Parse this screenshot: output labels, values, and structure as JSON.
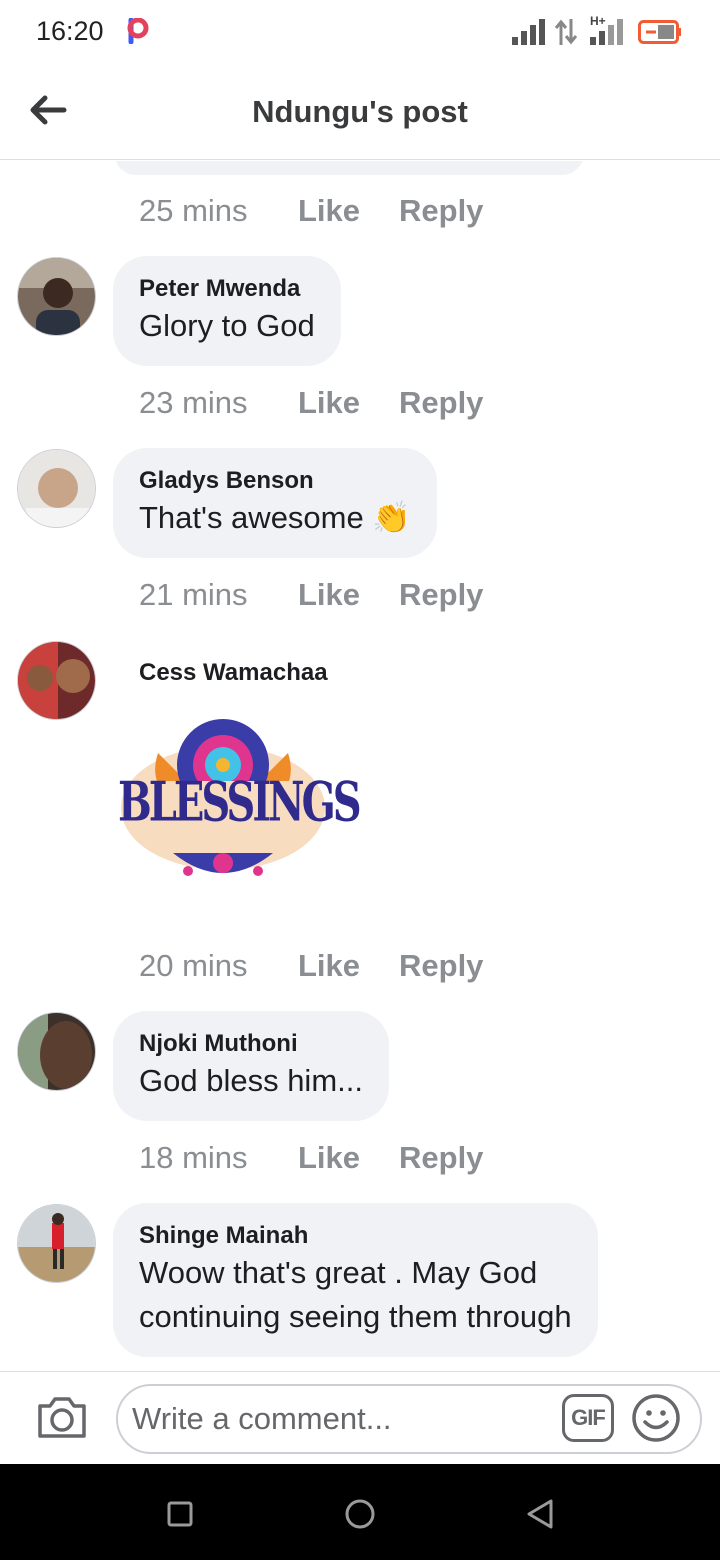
{
  "status_bar": {
    "time": "16:20",
    "network_label": "H+",
    "icons": [
      "pinterest-style-app-badge",
      "signal-bars-icon",
      "data-arrows-icon",
      "signal-bars-icon",
      "battery-icon"
    ],
    "colors": {
      "app_badge_primary": "#e4405f",
      "app_badge_secondary": "#3b5cf5",
      "battery_outline": "#f25c35"
    }
  },
  "header": {
    "title": "Ndungu's post",
    "back_icon": "back-arrow-icon"
  },
  "comments": [
    {
      "type": "partial",
      "time": "25 mins",
      "like": "Like",
      "reply": "Reply"
    },
    {
      "type": "text",
      "author": "Peter Mwenda",
      "text": "Glory to God",
      "time": "23 mins",
      "like": "Like",
      "reply": "Reply"
    },
    {
      "type": "text",
      "author": "Gladys Benson",
      "text": "That's awesome 👏",
      "time": "21 mins",
      "like": "Like",
      "reply": "Reply"
    },
    {
      "type": "sticker",
      "author": "Cess Wamachaa",
      "sticker_text": "BLESSINGS",
      "time": "20 mins",
      "like": "Like",
      "reply": "Reply"
    },
    {
      "type": "text",
      "author": "Njoki Muthoni",
      "text": "God bless him...",
      "time": "18 mins",
      "like": "Like",
      "reply": "Reply"
    },
    {
      "type": "text",
      "author": "Shinge Mainah",
      "text_lines": [
        "Woow that's great . May God",
        "continuing seeing them through"
      ]
    }
  ],
  "composer": {
    "placeholder": "Write a comment...",
    "gif_label": "GIF",
    "camera_icon": "camera-icon",
    "emoji_icon": "smiley-icon"
  },
  "navbar": {
    "icons": [
      "recents-square-icon",
      "home-circle-icon",
      "back-triangle-icon"
    ]
  },
  "theme": {
    "bubble_bg": "#f0f2f5",
    "meta_text": "#8a8d91",
    "header_text": "#3a3b3c"
  }
}
